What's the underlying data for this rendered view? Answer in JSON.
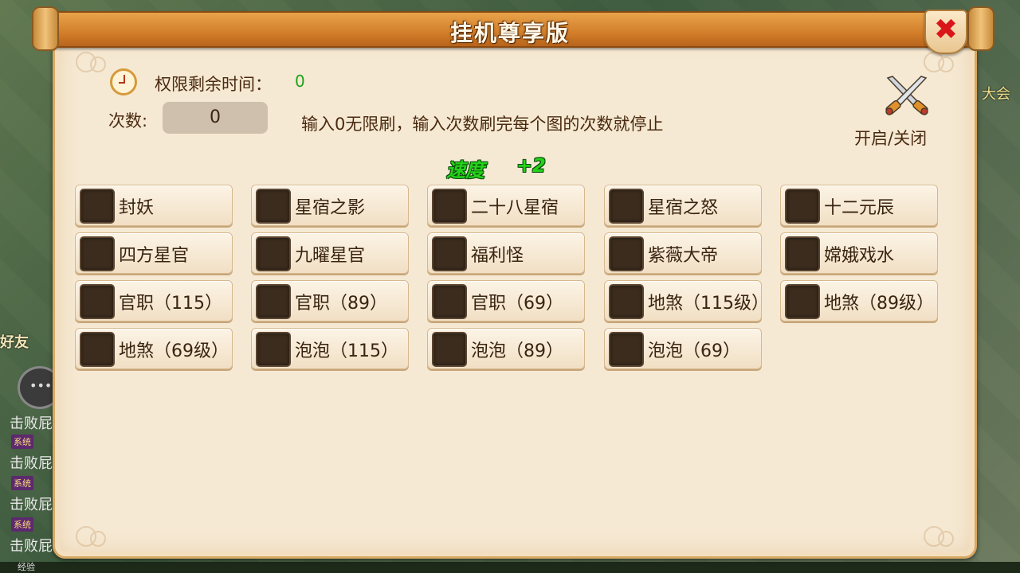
{
  "dialog": {
    "title": "挂机尊享版",
    "close_label": "✖",
    "remaining_time_label": "权限剩余时间：",
    "remaining_time_value": "0",
    "count_label": "次数:",
    "count_value": "0",
    "hint": "输入0无限刷，输入次数刷完每个图的次数就停止",
    "toggle_label": "开启/关闭",
    "speed_label": "速度",
    "speed_bonus": "+2",
    "options": [
      {
        "label": "封妖"
      },
      {
        "label": "星宿之影"
      },
      {
        "label": "二十八星宿"
      },
      {
        "label": "星宿之怒"
      },
      {
        "label": "十二元辰"
      },
      {
        "label": "四方星官"
      },
      {
        "label": "九曜星官"
      },
      {
        "label": "福利怪"
      },
      {
        "label": "紫薇大帝"
      },
      {
        "label": "嫦娥戏水"
      },
      {
        "label": "官职（115）"
      },
      {
        "label": "官职（89）"
      },
      {
        "label": "官职（69）"
      },
      {
        "label": "地煞（115级）"
      },
      {
        "label": "地煞（89级）"
      },
      {
        "label": "地煞（69级）"
      },
      {
        "label": "泡泡（115）"
      },
      {
        "label": "泡泡（89）"
      },
      {
        "label": "泡泡（69）"
      }
    ]
  },
  "background": {
    "friend_label": "好友",
    "chat_lines": [
      "击败屁",
      "击败屁",
      "击败屁",
      "击败屁"
    ],
    "system_tag": "系统",
    "right_text": "大会",
    "bottom_text": "经验",
    "chat_icon": "•••"
  },
  "icons": {
    "clock": "clock-icon",
    "toggle": "crossed-swords-icon",
    "close": "close-icon"
  },
  "colors": {
    "panel": "#f6e9d3",
    "title_bar": "#d27e2a",
    "close": "#d9161a",
    "speed": "#25d21a",
    "time_value": "#1ea11a"
  }
}
